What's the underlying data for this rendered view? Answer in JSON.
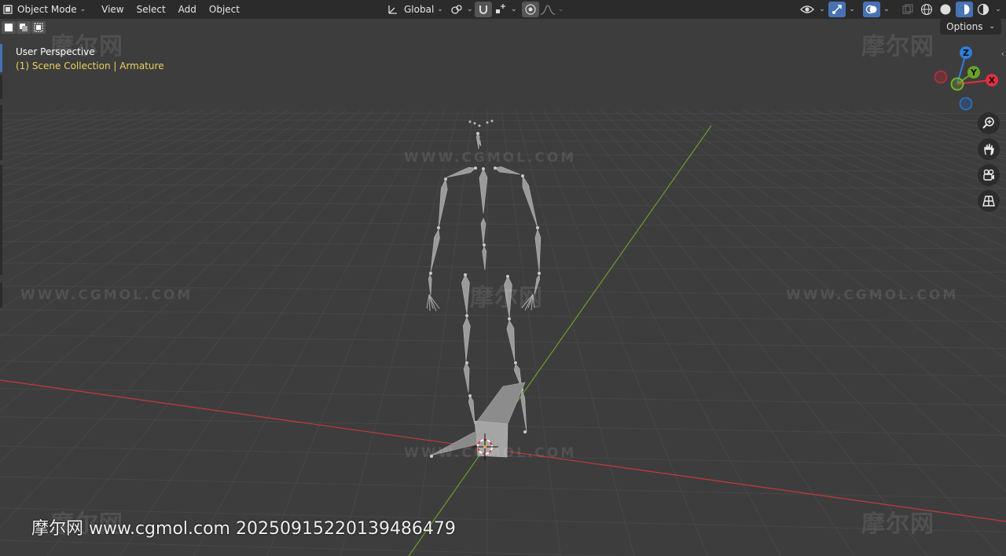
{
  "header": {
    "mode_label": "Object Mode",
    "menus": [
      "View",
      "Select",
      "Add",
      "Object"
    ],
    "orientation_label": "Global",
    "options_label": "Options"
  },
  "viewport": {
    "perspective_label": "User Perspective",
    "collection_label": "(1) Scene Collection | Armature"
  },
  "gizmo": {
    "z_label": "Z",
    "y_label": "Y",
    "x_label": "X",
    "colors": {
      "x": "#e0303f",
      "y": "#6aa324",
      "z": "#2e7fd9"
    }
  },
  "nav_tools": [
    "zoom-icon",
    "hand-pan-icon",
    "camera-icon",
    "grid-ortho-icon"
  ],
  "watermark": {
    "cn": "摩尔网",
    "url": "WWW.CGMOL.COM",
    "footer": "摩尔网 www.cgmol.com 20250915220139486479"
  },
  "colors": {
    "background": "#3d3d3d",
    "header": "#2b2b2b",
    "accent": "#4772b3",
    "x_axis": "#c43a3a",
    "y_axis": "#6c9c2e"
  }
}
